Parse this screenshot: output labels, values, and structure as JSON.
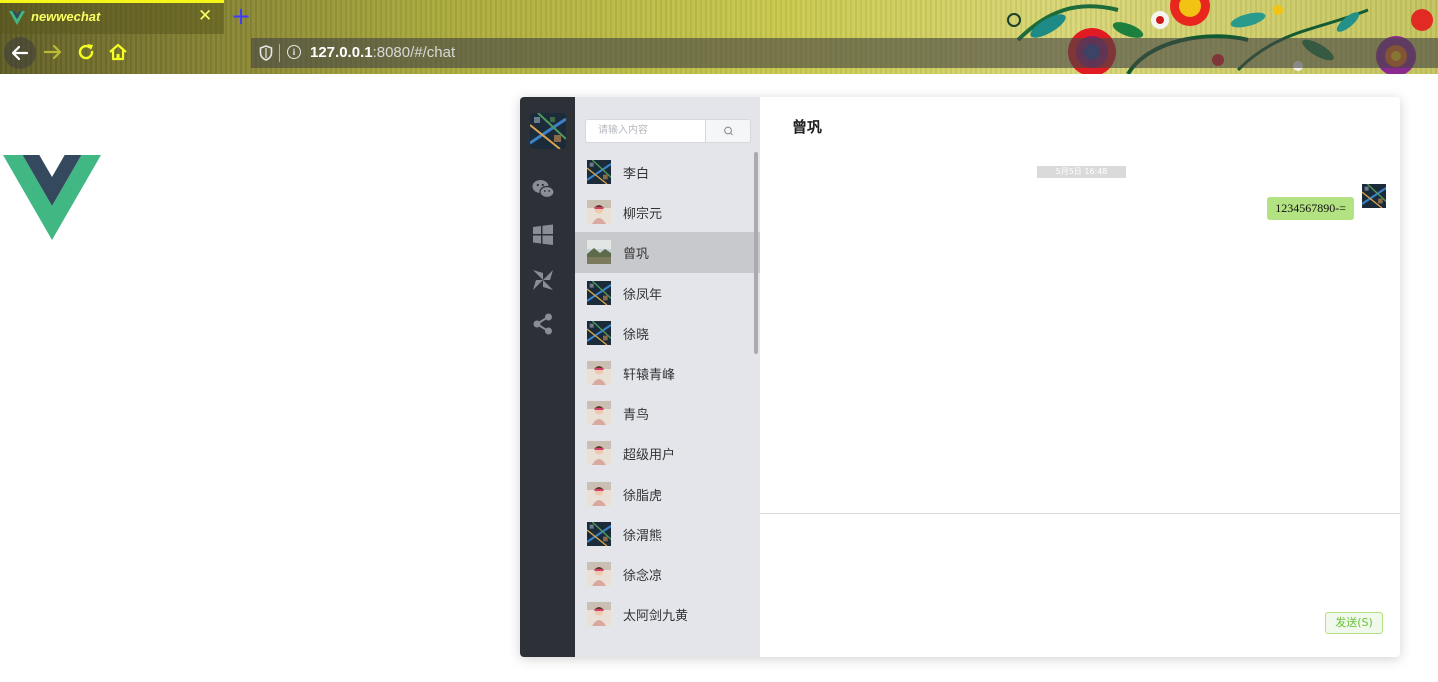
{
  "browser": {
    "tab_title": "newwechat",
    "close_glyph": "✕",
    "new_tab_glyph": "+",
    "url_host": "127.0.0.1",
    "url_path": ":8080/#/chat",
    "colors": {
      "tab_text": "#fbff63",
      "tab_border": "#f5f51a",
      "new_tab": "#3e3cff"
    }
  },
  "sidebar": {
    "icons": [
      "wechat-icon",
      "windows-icon",
      "pinwheel-icon",
      "share-icon"
    ]
  },
  "search": {
    "placeholder": "请输入内容",
    "icon": "search-icon"
  },
  "contacts": [
    {
      "name": "李白",
      "avatar": "city-aerial"
    },
    {
      "name": "柳宗元",
      "avatar": "girl-photo"
    },
    {
      "name": "曾巩",
      "avatar": "landscape",
      "active": true
    },
    {
      "name": "徐凤年",
      "avatar": "city-aerial"
    },
    {
      "name": "徐晓",
      "avatar": "city-aerial"
    },
    {
      "name": "轩辕青峰",
      "avatar": "girl-photo"
    },
    {
      "name": "青鸟",
      "avatar": "girl-photo"
    },
    {
      "name": "超级用户",
      "avatar": "girl-photo"
    },
    {
      "name": "徐脂虎",
      "avatar": "girl-photo"
    },
    {
      "name": "徐渭熊",
      "avatar": "city-aerial"
    },
    {
      "name": "徐念凉",
      "avatar": "girl-photo"
    },
    {
      "name": "太阿剑九黄",
      "avatar": "girl-photo"
    }
  ],
  "chat": {
    "title": "曾巩",
    "timestamp": "5月5日 16:48",
    "messages": [
      {
        "text": "1234567890-=",
        "from": "self"
      }
    ],
    "send_label": "发送(S)"
  },
  "colors": {
    "sidebar_bg": "#2e3038",
    "list_bg": "#e3e5eb",
    "active_contact": "#c8c9cd",
    "bubble": "#b2e281",
    "send_text": "#67c23a"
  }
}
